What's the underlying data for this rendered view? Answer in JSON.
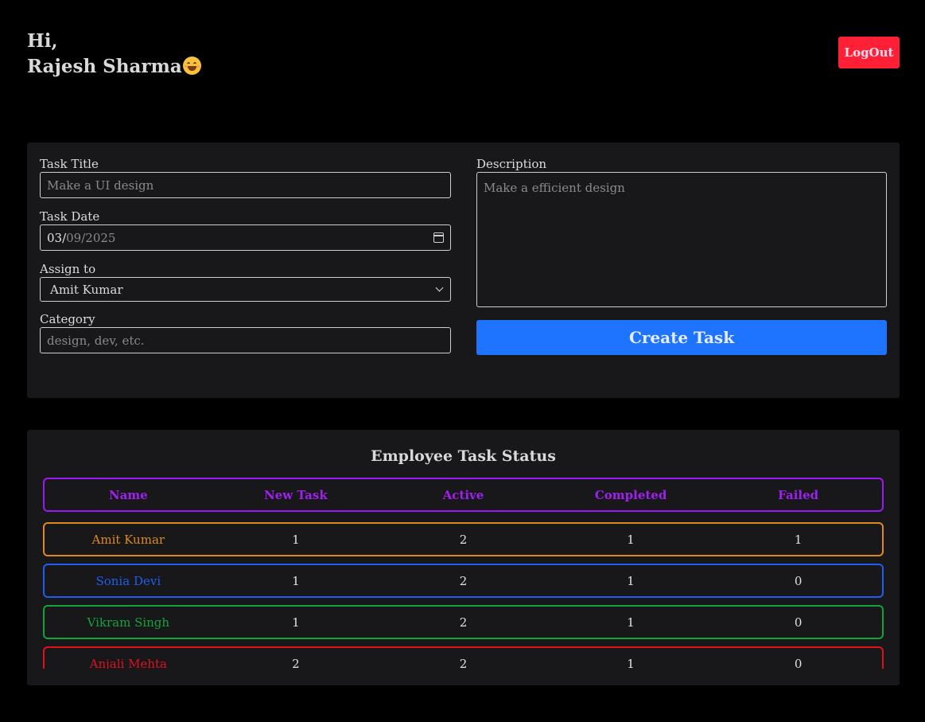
{
  "header": {
    "greeting_line1": "Hi,",
    "user_name": "Rajesh Sharma",
    "emoji": "smiling-face-icon",
    "logout_label": "LogOut"
  },
  "form": {
    "task_title_label": "Task Title",
    "task_title_placeholder": "Make a UI design",
    "task_date_label": "Task Date",
    "task_date_month": "03/",
    "task_date_rest": "09/2025",
    "assign_label": "Assign to",
    "assign_value": "Amit Kumar",
    "category_label": "Category",
    "category_placeholder": "design, dev, etc.",
    "description_label": "Description",
    "description_placeholder": "Make a efficient design",
    "create_button": "Create Task"
  },
  "status": {
    "title": "Employee Task Status",
    "columns": [
      "Name",
      "New Task",
      "Active",
      "Completed",
      "Failed"
    ],
    "rows": [
      {
        "name": "Amit Kumar",
        "new": "1",
        "active": "2",
        "completed": "1",
        "failed": "1",
        "color": "#e0891a"
      },
      {
        "name": "Sonia Devi",
        "new": "1",
        "active": "2",
        "completed": "1",
        "failed": "0",
        "color": "#1f5cf0"
      },
      {
        "name": "Vikram Singh",
        "new": "1",
        "active": "2",
        "completed": "1",
        "failed": "0",
        "color": "#12a33a"
      },
      {
        "name": "Anjali Mehta",
        "new": "2",
        "active": "2",
        "completed": "1",
        "failed": "0",
        "color": "#e0101e"
      }
    ]
  },
  "colors": {
    "accent_blue": "#1e73ff",
    "logout_red": "#ff2035",
    "header_purple": "#a020f0"
  }
}
